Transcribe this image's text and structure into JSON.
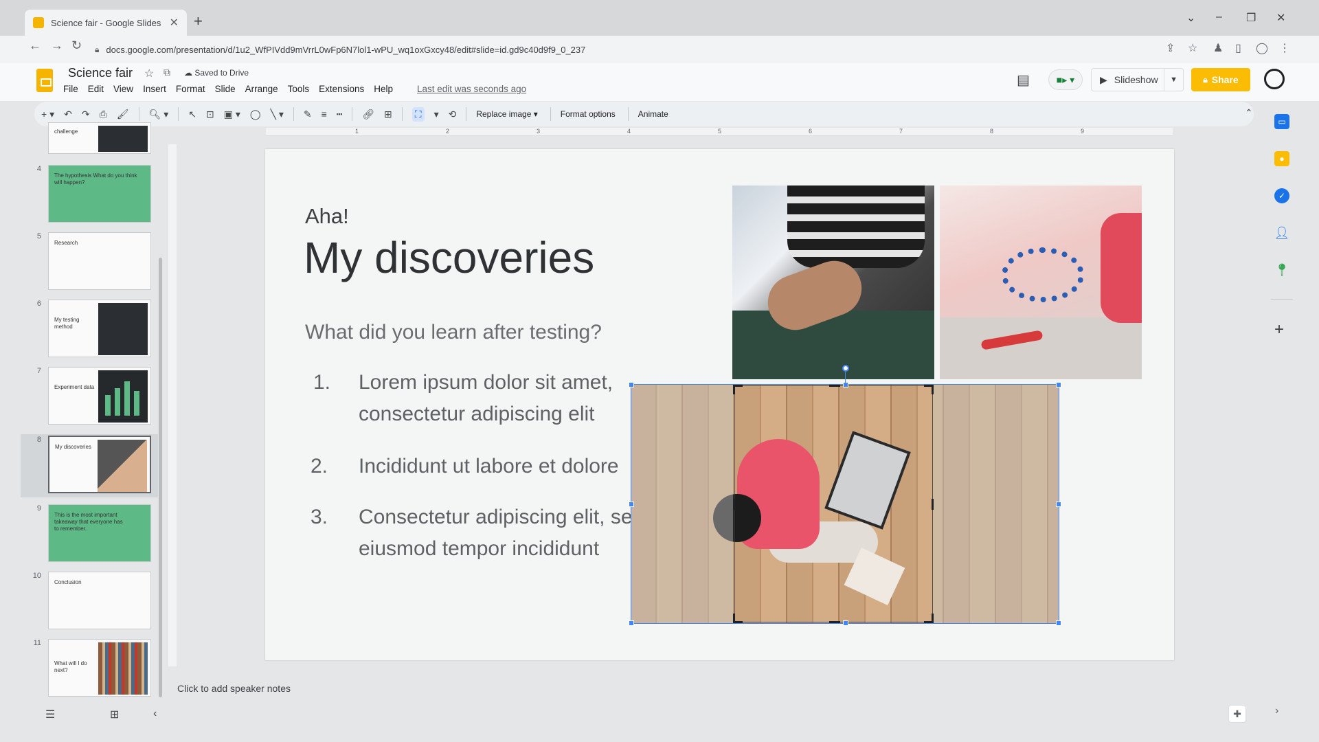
{
  "browser": {
    "tab_title": "Science fair - Google Slides",
    "url": "docs.google.com/presentation/d/1u2_WfPIVdd9mVrrL0wFp6N7lol1-wPU_wq1oxGxcy48/edit#slide=id.gd9c40d9f9_0_237"
  },
  "doc": {
    "title": "Science fair",
    "saved_status": "Saved to Drive",
    "menu": [
      "File",
      "Edit",
      "View",
      "Insert",
      "Format",
      "Slide",
      "Arrange",
      "Tools",
      "Extensions",
      "Help"
    ],
    "last_edit": "Last edit was seconds ago",
    "slideshow_label": "Slideshow",
    "share_label": "Share"
  },
  "toolbar": {
    "replace_image": "Replace image",
    "format_options": "Format options",
    "animate": "Animate"
  },
  "ruler": {
    "numbers": [
      "1",
      "2",
      "3",
      "4",
      "5",
      "6",
      "7",
      "8",
      "9"
    ]
  },
  "filmstrip": {
    "slides": [
      {
        "num": "",
        "title": "challenge"
      },
      {
        "num": "4",
        "title": "The hypothesis  What do you think will happen?"
      },
      {
        "num": "5",
        "title": "Research"
      },
      {
        "num": "6",
        "title": "My testing method"
      },
      {
        "num": "7",
        "title": "Experiment data"
      },
      {
        "num": "8",
        "title": "My discoveries"
      },
      {
        "num": "9",
        "title": "This is the most important takeaway that everyone has to remember."
      },
      {
        "num": "10",
        "title": "Conclusion"
      },
      {
        "num": "11",
        "title": "What will I do next?"
      }
    ]
  },
  "slide": {
    "kicker": "Aha!",
    "heading": "My discoveries",
    "question": "What did you learn after testing?",
    "list": [
      {
        "num": "1.",
        "text": "Lorem ipsum dolor sit amet, consectetur adipiscing elit"
      },
      {
        "num": "2.",
        "text": "Incididunt ut labore et dolore"
      },
      {
        "num": "3.",
        "text": "Consectetur adipiscing elit, sed do eiusmod tempor incididunt"
      }
    ]
  },
  "notes": {
    "placeholder": "Click to add speaker notes"
  },
  "colors": {
    "accent": "#4285f4",
    "share": "#fbbc04",
    "slide_green": "#5dba86"
  }
}
